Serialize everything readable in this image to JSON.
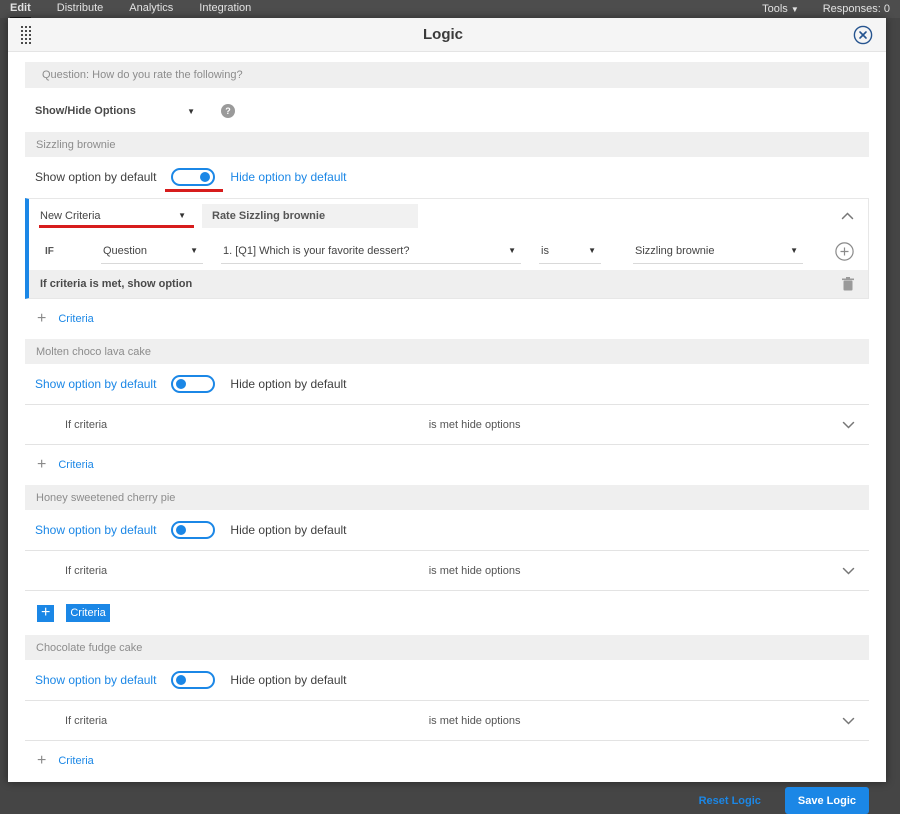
{
  "topbar": {
    "tabs": [
      {
        "label": "Edit"
      },
      {
        "label": "Distribute"
      },
      {
        "label": "Analytics"
      },
      {
        "label": "Integration"
      }
    ],
    "tools_label": "Tools",
    "responses_label": "Responses: 0"
  },
  "modal": {
    "title": "Logic",
    "question_bar": "Question: How do you rate the following?",
    "logic_type_value": "Show/Hide Options",
    "help_glyph": "?",
    "labels": {
      "show_default": "Show option by default",
      "hide_default": "Hide option by default",
      "add_criteria": "Criteria",
      "plus": "+",
      "if": "IF",
      "reset": "Reset Logic",
      "save": "Save Logic"
    },
    "sections": [
      {
        "name": "Sizzling brownie",
        "expanded_criteria": {
          "criteria_name": "New Criteria",
          "description": "Rate Sizzling brownie",
          "field_type": "Question",
          "question": "1. [Q1] Which is your favorite dessert?",
          "operator": "is",
          "value": "Sizzling brownie",
          "footer": "If criteria is met, show option"
        }
      },
      {
        "name": "Molten choco lava cake",
        "collapsed": {
          "left": "If criteria",
          "center": "is met hide options"
        }
      },
      {
        "name": "Honey sweetened cherry pie",
        "collapsed": {
          "left": "If criteria",
          "center": "is met hide options"
        }
      },
      {
        "name": "Chocolate fudge cake",
        "collapsed": {
          "left": "If criteria",
          "center": "is met hide options"
        }
      }
    ],
    "colors": {
      "accent_blue": "#1b87e6",
      "annotation_red": "#d71c1c",
      "topbar_bg": "#4d4d4d",
      "section_bar_bg": "#efefef"
    }
  }
}
